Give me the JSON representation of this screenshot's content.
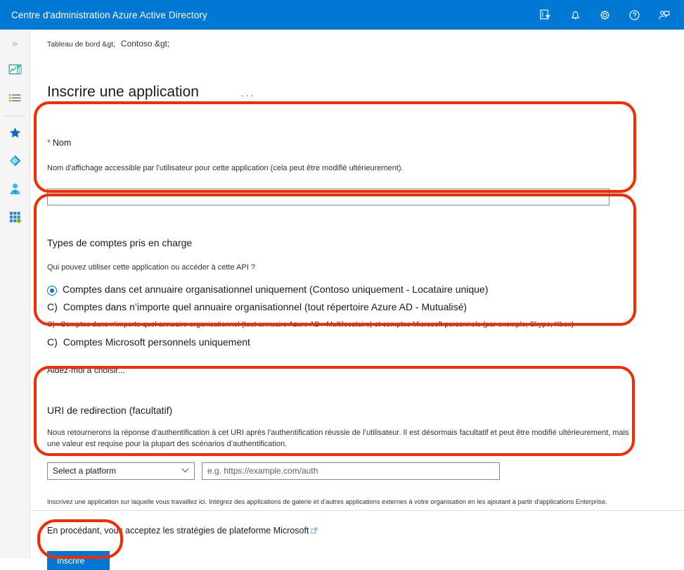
{
  "topbar": {
    "title": "Centre d'administration Azure Active Directory",
    "icons": [
      {
        "name": "directory-filter-icon",
        "glyph": "directory-filter"
      },
      {
        "name": "notifications-bell-icon",
        "glyph": "bell"
      },
      {
        "name": "settings-gear-icon",
        "glyph": "gear"
      },
      {
        "name": "help-question-icon",
        "glyph": "question"
      },
      {
        "name": "feedback-person-icon",
        "glyph": "feedback"
      }
    ]
  },
  "rail": {
    "expand_glyph": "»",
    "items": [
      {
        "name": "dashboard-icon",
        "label": "Tableau de bord"
      },
      {
        "name": "all-resources-list-icon",
        "label": "Toutes les ressources"
      },
      {
        "name": "favorites-star-icon",
        "label": "Favoris"
      },
      {
        "name": "azure-ad-icon",
        "label": "Azure Active Directory"
      },
      {
        "name": "users-icon",
        "label": "Utilisateurs"
      },
      {
        "name": "all-services-grid-icon",
        "label": "Tous les services"
      }
    ]
  },
  "breadcrumb": {
    "crumb1": "Tableau de bord &gt;",
    "crumb2": "Contoso &gt;"
  },
  "page": {
    "title": "Inscrire une application",
    "more_actions": "···"
  },
  "name_section": {
    "required_star": "*",
    "label": "Nom",
    "description": "Nom d'affichage accessible par l'utilisateur pour cette application (cela peut être modifié ultérieurement).",
    "input_value": "",
    "input_placeholder": ""
  },
  "account_types": {
    "heading": "Types de comptes pris en charge",
    "question": "Qui pouvez utiliser cette application ou accéder à cette API ?",
    "options": [
      {
        "marker": "",
        "selected": true,
        "label": "Comptes dans cet annuaire organisationnel uniquement (Contoso uniquement - Locataire unique)",
        "size": "normal"
      },
      {
        "marker": "C)",
        "selected": false,
        "label": "Comptes dans n’importe quel annuaire organisationnel (tout répertoire Azure AD - Mutualisé)",
        "size": "normal"
      },
      {
        "marker": "C)",
        "selected": false,
        "label": "Comptes dans n’importe quel annuaire organisationnel (tout annuaire Azure AD - Multilocataire) et comptes Microsoft personnels (par exemple, Skype, Xbox)",
        "size": "small"
      },
      {
        "marker": "C)",
        "selected": false,
        "label": "Comptes Microsoft personnels uniquement",
        "size": "normal"
      }
    ],
    "help_link": "Aidez-moi à choisir..."
  },
  "redirect_uri": {
    "heading": "URI de redirection (facultatif)",
    "description": "Nous retournerons la réponse d’authentification à cet URI après l'authentification réussie de l’utilisateur. Il est désormais facultatif et peut être modifié ultérieurement, mais une valeur est requise pour la plupart des scénarios d’authentification.",
    "platform_select_value": "Select a platform",
    "platform_chevron": "∨",
    "uri_value": "",
    "uri_placeholder": "e.g. https://example.com/auth"
  },
  "fineprint": "Inscrivez une application sur laquelle vous travaillez ici. Intégrez des applications de galerie et d'autres applications externes à votre organisation en les ajoutant à partir d'applications Enterprise.",
  "footer": {
    "note": "En procédant, vous acceptez les stratégies de plateforme Microsoft",
    "external_link_icon": "external-link-icon",
    "submit_label": "Inscrire"
  },
  "annotations": {
    "color": "#f62b00",
    "regions": [
      "nom-field",
      "types-de-comptes",
      "uri-de-redirection",
      "inscrire-button"
    ]
  }
}
